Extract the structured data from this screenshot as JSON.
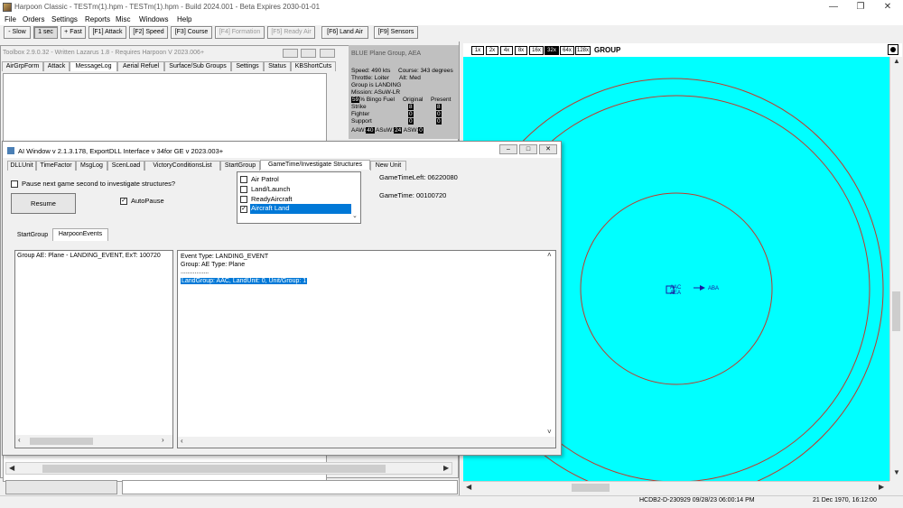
{
  "app": {
    "title": "Harpoon Classic - TESTm(1).hpm - TESTm(1).hpm - Build 2024.001 - Beta Expires 2030-01-01",
    "window_controls": [
      "—",
      "❐",
      "✕"
    ]
  },
  "menu": [
    "File",
    "Orders",
    "Settings",
    "Reports",
    "Misc",
    "Windows",
    "Help"
  ],
  "toolbar": [
    {
      "label": "- Slow",
      "state": "normal"
    },
    {
      "label": "1 sec",
      "state": "selected"
    },
    {
      "label": "+ Fast",
      "state": "normal"
    },
    {
      "label": "[F1] Attack",
      "state": "normal"
    },
    {
      "label": "[F2] Speed",
      "state": "normal"
    },
    {
      "label": "[F3] Course",
      "state": "normal"
    },
    {
      "label": "[F4] Formation",
      "state": "disabled"
    },
    {
      "label": "[F5] Ready Air",
      "state": "disabled"
    },
    {
      "label": "[F6] Land Air",
      "state": "normal"
    },
    {
      "label": "[F9] Sensors",
      "state": "normal"
    }
  ],
  "map": {
    "zoom_levels": [
      "1x",
      "2x",
      "4x",
      "8x",
      "16x",
      "32x",
      "64x",
      "128x"
    ],
    "active_zoom": "32x",
    "header_label": "GROUP",
    "background": "#00ffff",
    "ring_color": "#c0392b",
    "unit_labels": [
      "AAC",
      "AEA",
      "ABA"
    ]
  },
  "toolbox": {
    "title": "Toolbox 2.9.0.32 - Written Lazarus 1.8 - Requires Harpoon V 2023.006+",
    "tabs": [
      "AirGrpForm",
      "Attack",
      "MessageLog",
      "Aerial Refuel",
      "Surface/Sub Groups",
      "Settings",
      "Status",
      "KBShortCuts"
    ],
    "active_tab": "MessageLog"
  },
  "info_panel": {
    "header": "BLUE Plane Group, AEA",
    "speed": "Speed: 490 kts",
    "course": "Course: 343 degrees",
    "throttle": "Throttle: Loiter",
    "alt": "Alt: Med",
    "group": "Group is LANDING",
    "mission": "Mission: ASuW-LR",
    "bingo_value": "59",
    "bingo_label": "% Bingo Fuel",
    "col_original": "Original",
    "col_present": "Present",
    "rows": [
      {
        "label": "Strike",
        "original": "8",
        "present": "8"
      },
      {
        "label": "Fighter",
        "original": "0",
        "present": "0"
      },
      {
        "label": "Support",
        "original": "0",
        "present": "0"
      }
    ],
    "aaw_label": "AAW:",
    "aaw_value": "40",
    "asuw_label": "ASuW:",
    "asuw_value": "24",
    "asw_label": "ASW:",
    "asw_value": "0"
  },
  "ai_window": {
    "title": "AI Window v 2.1.3.178, ExportDLL Interface v 34for GE v 2023.003+",
    "tabs": [
      "DLLUnit",
      "TimeFactor",
      "MsgLog",
      "ScenLoad",
      "VictoryConditionsList",
      "StartGroup",
      "GameTime/Investigate Structures",
      "New Unit"
    ],
    "active_tab": "GameTime/Investigate Structures",
    "pause_label": "Pause next game second to investigate structures?",
    "resume_label": "Resume",
    "autopause_label": "AutoPause",
    "event_list": [
      "Air Patrol",
      "Land/Launch",
      "ReadyAircraft",
      "Aircraft Land"
    ],
    "event_selected": "Aircraft Land",
    "game_time_left": "GameTimeLeft: 06220080",
    "game_time": "GameTime: 00100720",
    "sub_tabs": [
      "StartGroup",
      "HarpoonEvents"
    ],
    "active_sub_tab": "HarpoonEvents",
    "left_list_item": "Group AE: Plane - LANDING_EVENT, ExT: 100720",
    "detail_line1": "Event Type: LANDING_EVENT",
    "detail_line2": "Group: AE Type: Plane",
    "detail_line3": "................",
    "detail_selected": "LandGroup: AAC, LandUnit: 0, Unit/Group: 1"
  },
  "status_bar": {
    "build": "HCDB2-D-230929 09/28/23 06:00:14 PM",
    "date": "21 Dec 1970, 16:12:00"
  }
}
